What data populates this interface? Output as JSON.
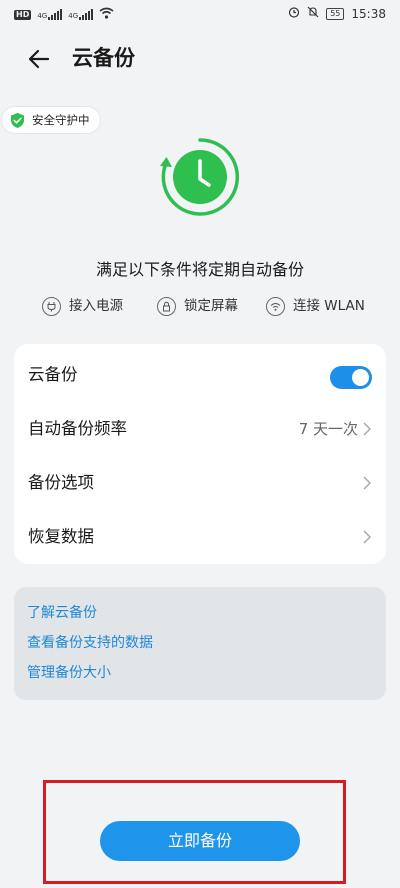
{
  "status_bar": {
    "hd_badge": "HD",
    "signal_1": "4G",
    "signal_2": "4G",
    "battery": "55",
    "time": "15:38"
  },
  "header": {
    "title": "云备份"
  },
  "security_badge": {
    "label": "安全守护中"
  },
  "conditions": {
    "title": "满足以下条件将定期自动备份",
    "items": [
      {
        "label": "接入电源",
        "icon": "plug-icon"
      },
      {
        "label": "锁定屏幕",
        "icon": "lock-icon"
      },
      {
        "label": "连接 WLAN",
        "icon": "wifi-icon"
      }
    ]
  },
  "settings": {
    "cloud_backup": {
      "label": "云备份",
      "enabled": true
    },
    "frequency": {
      "label": "自动备份频率",
      "value": "7 天一次"
    },
    "options": {
      "label": "备份选项"
    },
    "restore": {
      "label": "恢复数据"
    }
  },
  "links": [
    "了解云备份",
    "查看备份支持的数据",
    "管理备份大小"
  ],
  "backup_now": {
    "label": "立即备份"
  },
  "colors": {
    "accent": "#1e95ea",
    "link": "#1e88d4",
    "green": "#2fbf4f",
    "highlight_box": "#d41c22"
  }
}
